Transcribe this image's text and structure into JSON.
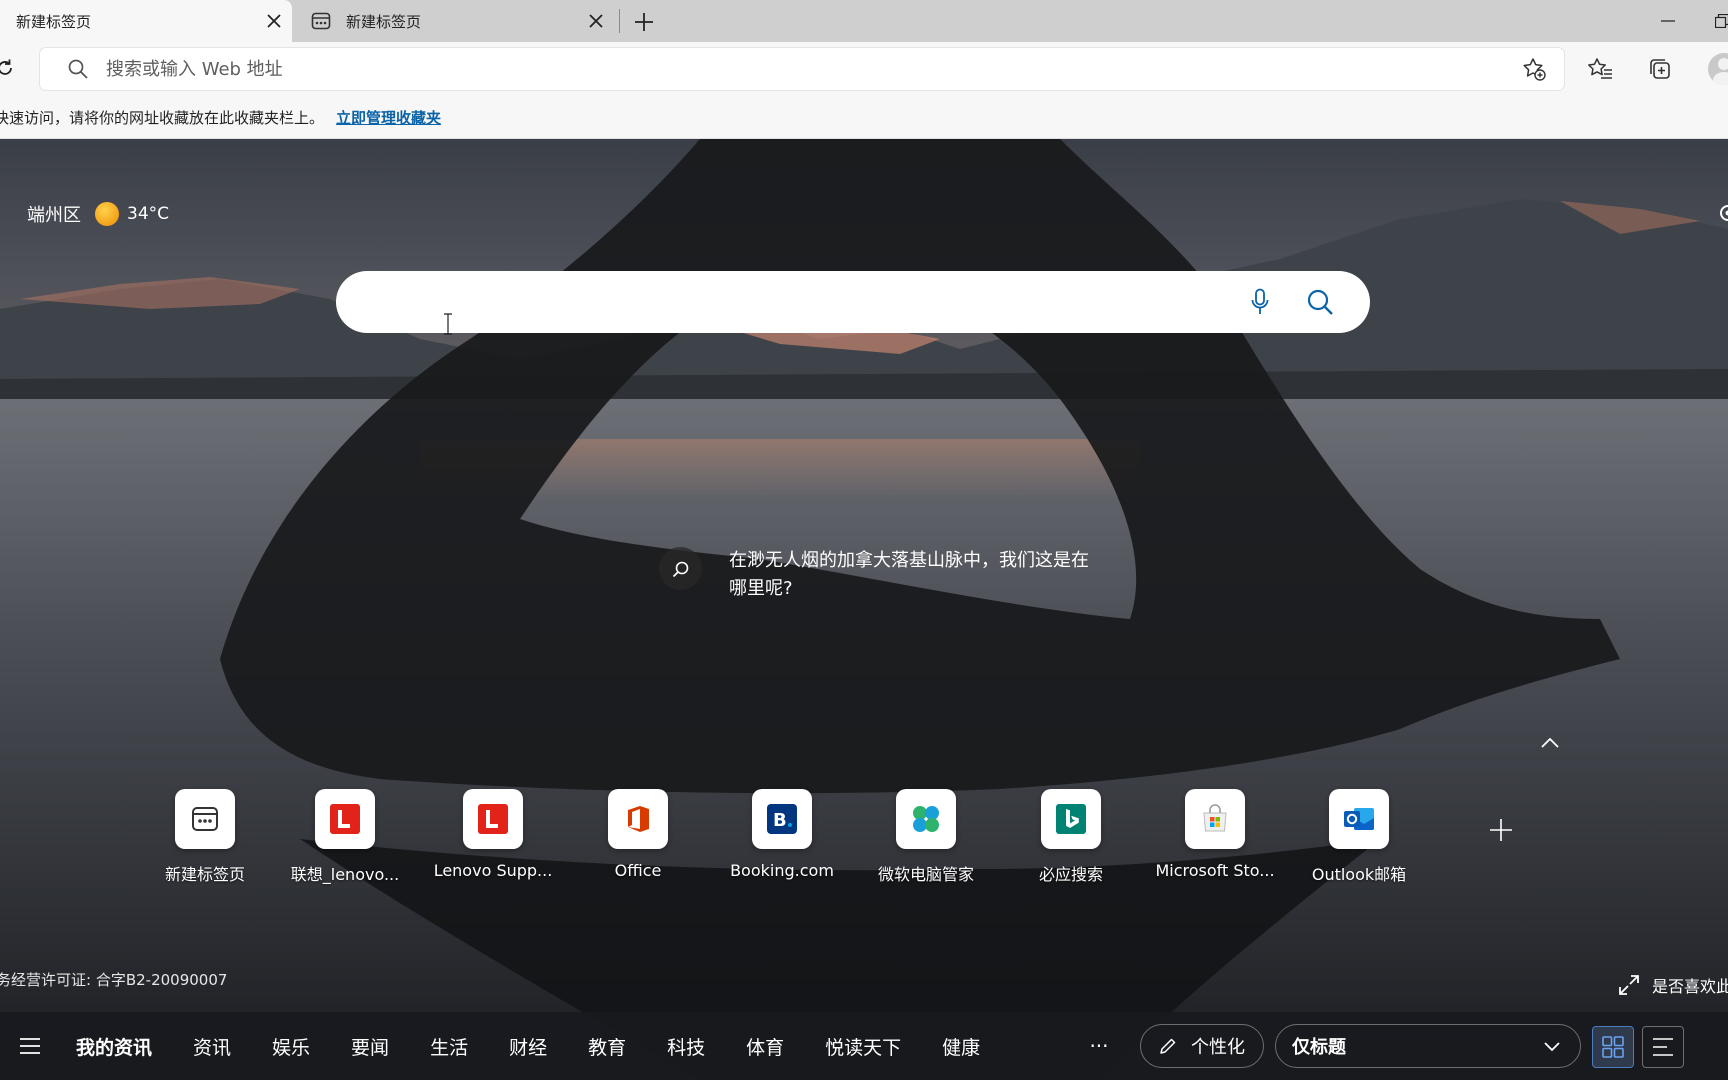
{
  "tabs": [
    {
      "label": "新建标签页",
      "active": true
    },
    {
      "label": "新建标签页",
      "active": false
    }
  ],
  "address_bar": {
    "placeholder": "搜索或输入 Web 地址",
    "value": ""
  },
  "favorites_bar": {
    "message": "快速访问，请将你的网址收藏放在此收藏夹栏上。",
    "link_label": "立即管理收藏夹"
  },
  "weather": {
    "location": "端州区",
    "temperature": "34°C"
  },
  "image_caption": "在渺无人烟的加拿大落基山脉中，我们这是在哪里呢?",
  "quick_links": [
    {
      "name": "新建标签页",
      "icon": "new-tab-page-icon"
    },
    {
      "name": "联想_lenovo...",
      "icon": "lenovo-icon"
    },
    {
      "name": "Lenovo Supp...",
      "icon": "lenovo-support-icon"
    },
    {
      "name": "Office",
      "icon": "office-icon"
    },
    {
      "name": "Booking.com",
      "icon": "booking-icon"
    },
    {
      "name": "微软电脑管家",
      "icon": "pc-manager-icon"
    },
    {
      "name": "必应搜索",
      "icon": "bing-icon"
    },
    {
      "name": "Microsoft Sto...",
      "icon": "microsoft-store-icon"
    },
    {
      "name": "Outlook邮箱",
      "icon": "outlook-icon"
    }
  ],
  "license": "务经营许可证: 合字B2-20090007",
  "feedback_label": "是否喜欢此",
  "news_nav": {
    "items": [
      "我的资讯",
      "资讯",
      "娱乐",
      "要闻",
      "生活",
      "财经",
      "教育",
      "科技",
      "体育",
      "悦读天下",
      "健康"
    ],
    "more": "···",
    "personalize": "个性化",
    "layout_value": "仅标题"
  },
  "colors": {
    "accent_link": "#0b63a8",
    "office": "#d83b01",
    "booking": "#003580",
    "bing": "#008373",
    "outlook": "#0a64c9",
    "lenovo": "#e2231a"
  }
}
